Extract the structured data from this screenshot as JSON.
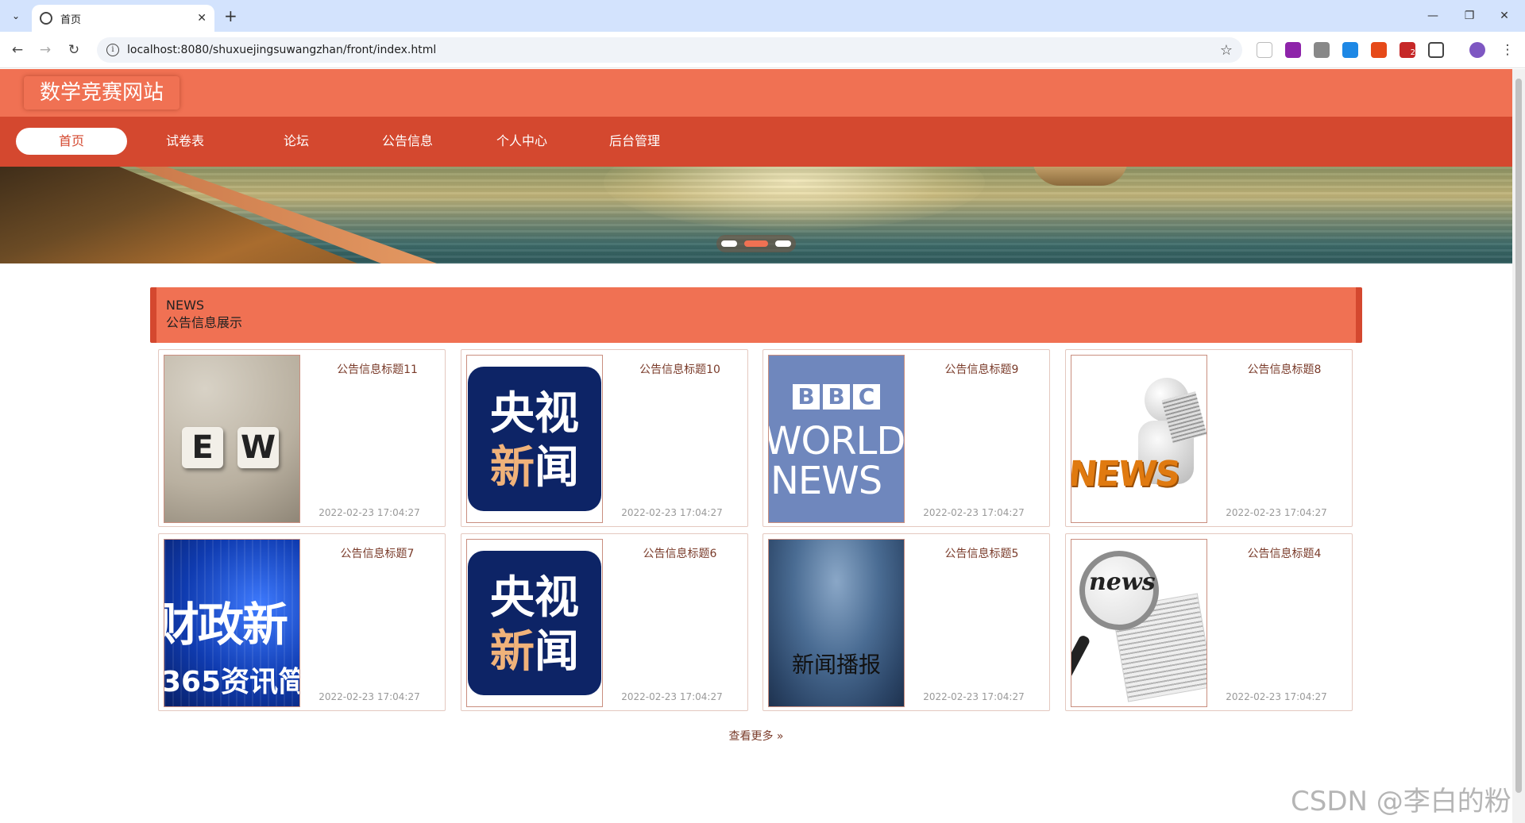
{
  "browser": {
    "tab_title": "首页",
    "url": "localhost:8080/shuxuejingsuwangzhan/front/index.html",
    "ext_badge": "2"
  },
  "site": {
    "logo": "数学竞赛网站",
    "nav": [
      {
        "label": "首页",
        "active": true
      },
      {
        "label": "试卷表"
      },
      {
        "label": "论坛"
      },
      {
        "label": "公告信息"
      },
      {
        "label": "个人中心"
      },
      {
        "label": "后台管理"
      }
    ],
    "colors": {
      "header": "#f07153",
      "nav": "#d4482f",
      "accent_text": "#7a3b2a"
    }
  },
  "banner": {
    "slide_count": 3,
    "active_slide": 2
  },
  "news": {
    "heading_en": "NEWS",
    "heading_zh": "公告信息展示",
    "items": [
      {
        "title": "公告信息标题11",
        "time": "2022-02-23 17:04:27",
        "thumb_text": "EW"
      },
      {
        "title": "公告信息标题10",
        "time": "2022-02-23 17:04:27",
        "thumb_line1": "央视",
        "thumb_line2a": "新",
        "thumb_line2b": "闻"
      },
      {
        "title": "公告信息标题9",
        "time": "2022-02-23 17:04:27",
        "thumb_logo": [
          "B",
          "B",
          "C"
        ],
        "thumb_line1": "WORLD",
        "thumb_line2": "NEWS"
      },
      {
        "title": "公告信息标题8",
        "time": "2022-02-23 17:04:27",
        "thumb_text": "NEWS"
      },
      {
        "title": "公告信息标题7",
        "time": "2022-02-23 17:04:27",
        "thumb_line1": "财政新",
        "thumb_line2": "365资讯简"
      },
      {
        "title": "公告信息标题6",
        "time": "2022-02-23 17:04:27",
        "thumb_line1": "央视",
        "thumb_line2a": "新",
        "thumb_line2b": "闻"
      },
      {
        "title": "公告信息标题5",
        "time": "2022-02-23 17:04:27",
        "thumb_text": "新闻播报"
      },
      {
        "title": "公告信息标题4",
        "time": "2022-02-23 17:04:27",
        "thumb_text": "news"
      }
    ],
    "more_label": "查看更多 »"
  },
  "watermark": "CSDN @李白的粉"
}
